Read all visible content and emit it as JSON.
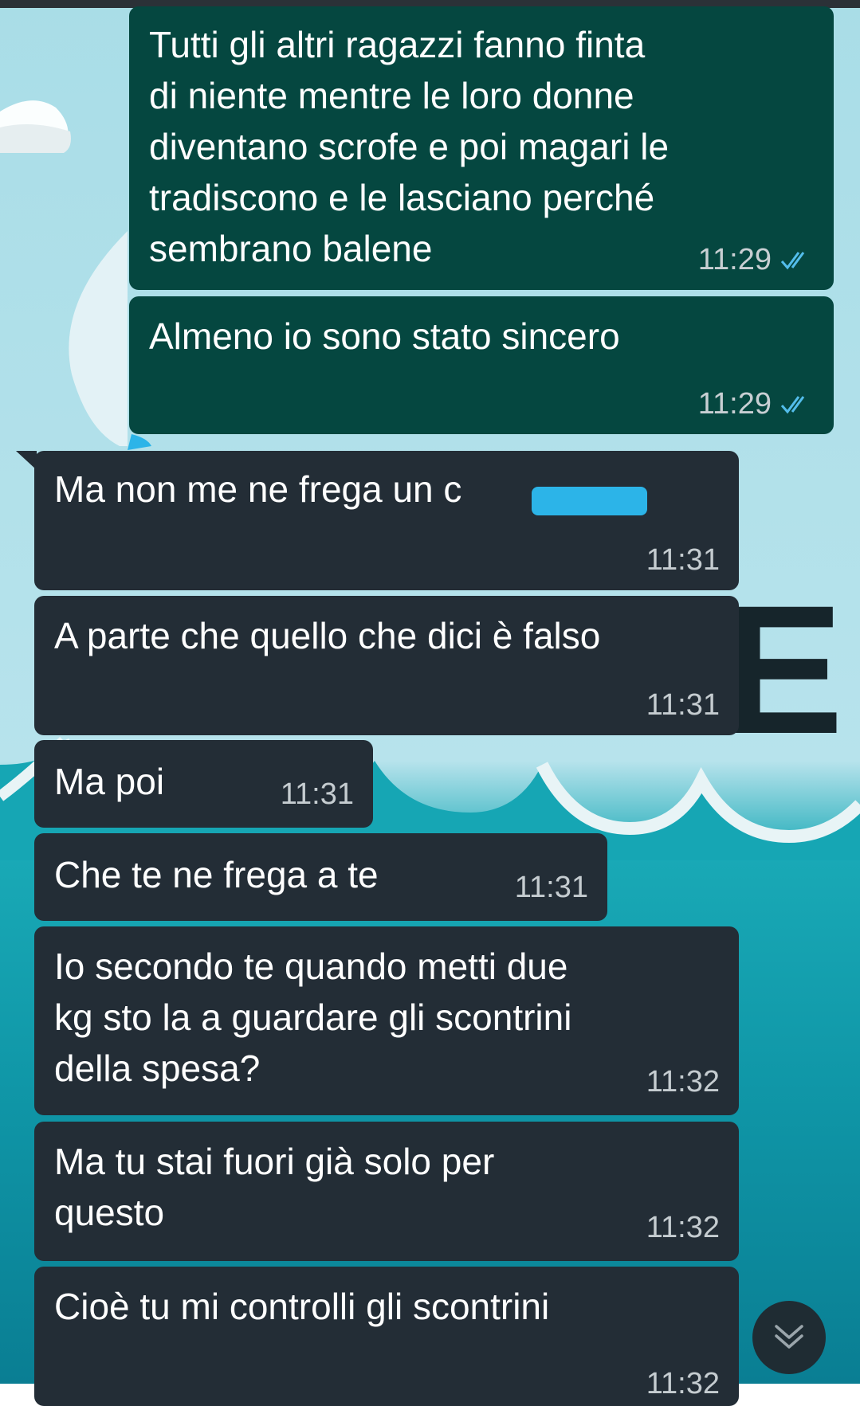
{
  "chat": {
    "messages": [
      {
        "direction": "outgoing",
        "text": "Tutti gli altri ragazzi fanno finta\ndi niente mentre le loro donne\ndiventano scrofe e poi magari le\ntradiscono e le lasciano perché\nsembrano balene",
        "time": "11:29",
        "status": "read"
      },
      {
        "direction": "outgoing",
        "text": "Almeno io sono stato sincero",
        "time": "11:29",
        "status": "read"
      },
      {
        "direction": "incoming",
        "text": "Ma non me ne frega un c",
        "time": "11:31",
        "redacted": true
      },
      {
        "direction": "incoming",
        "text": "A parte che quello che dici è falso",
        "time": "11:31"
      },
      {
        "direction": "incoming",
        "text": "Ma poi",
        "time": "11:31"
      },
      {
        "direction": "incoming",
        "text": "Che te ne frega a te",
        "time": "11:31"
      },
      {
        "direction": "incoming",
        "text": "Io secondo te quando metti due\nkg sto la a guardare gli scontrini\ndella spesa?",
        "time": "11:32"
      },
      {
        "direction": "incoming",
        "text": "Ma tu stai fuori già solo per\nquesto",
        "time": "11:32"
      },
      {
        "direction": "incoming",
        "text": "Cioè tu mi controlli gli scontrini",
        "time": "11:32"
      }
    ]
  },
  "wallpaper": {
    "letter": "E"
  },
  "colors": {
    "outgoing_bubble": "#054740",
    "incoming_bubble": "#232d36",
    "read_tick": "#53bdeb",
    "redaction": "#2cb4e8"
  },
  "icons": {
    "scroll_down": "double-chevron-down-icon",
    "read_receipt": "double-check-icon"
  }
}
